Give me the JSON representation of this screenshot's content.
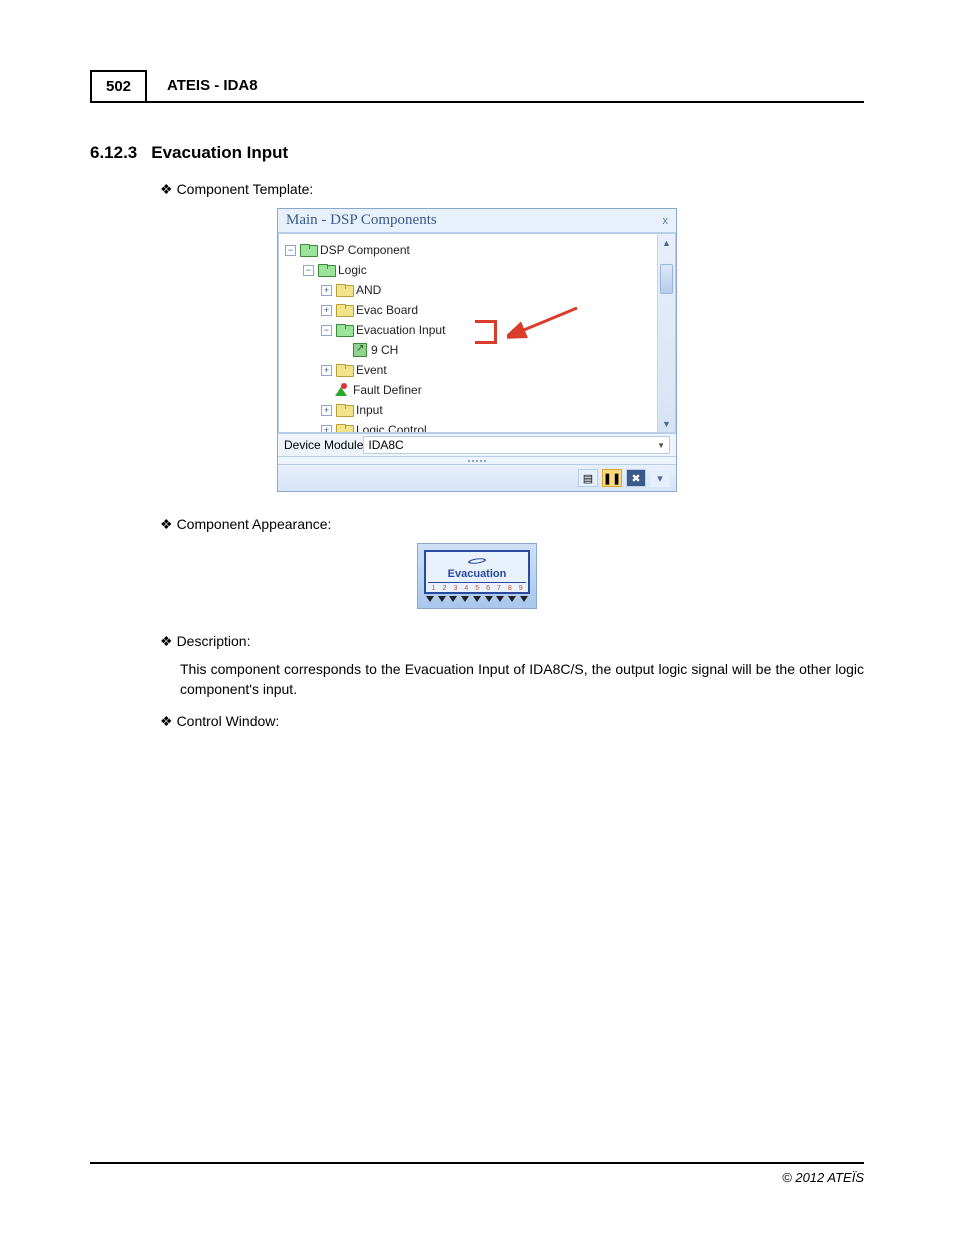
{
  "header": {
    "page_number": "502",
    "doc_title": "ATEIS - IDA8"
  },
  "section": {
    "number": "6.12.3",
    "title": "Evacuation Input"
  },
  "bullets": {
    "template": "Component Template:",
    "appearance": "Component Appearance:",
    "description": "Description:",
    "control": "Control Window:"
  },
  "description_text": "This component corresponds to the Evacuation Input of IDA8C/S, the output logic signal will be the other logic component's input.",
  "panel": {
    "title": "Main - DSP Components",
    "close": "x",
    "tree": {
      "root": "DSP Component",
      "logic": "Logic",
      "items": {
        "and": "AND",
        "evac_board": "Evac Board",
        "evac_input": "Evacuation Input",
        "evac_input_child": "9 CH",
        "event": "Event",
        "fault_definer": "Fault Definer",
        "input": "Input",
        "logic_control": "Logic Control"
      }
    },
    "device_label": "Device Module",
    "device_value": "IDA8C",
    "status_icons": {
      "a": "▤",
      "b": "❚❚",
      "c": "✖",
      "d": "▾"
    }
  },
  "component": {
    "label": "Evacuation",
    "pins": [
      "1",
      "2",
      "3",
      "4",
      "5",
      "6",
      "7",
      "8",
      "9"
    ]
  },
  "footer": "© 2012 ATEÏS"
}
